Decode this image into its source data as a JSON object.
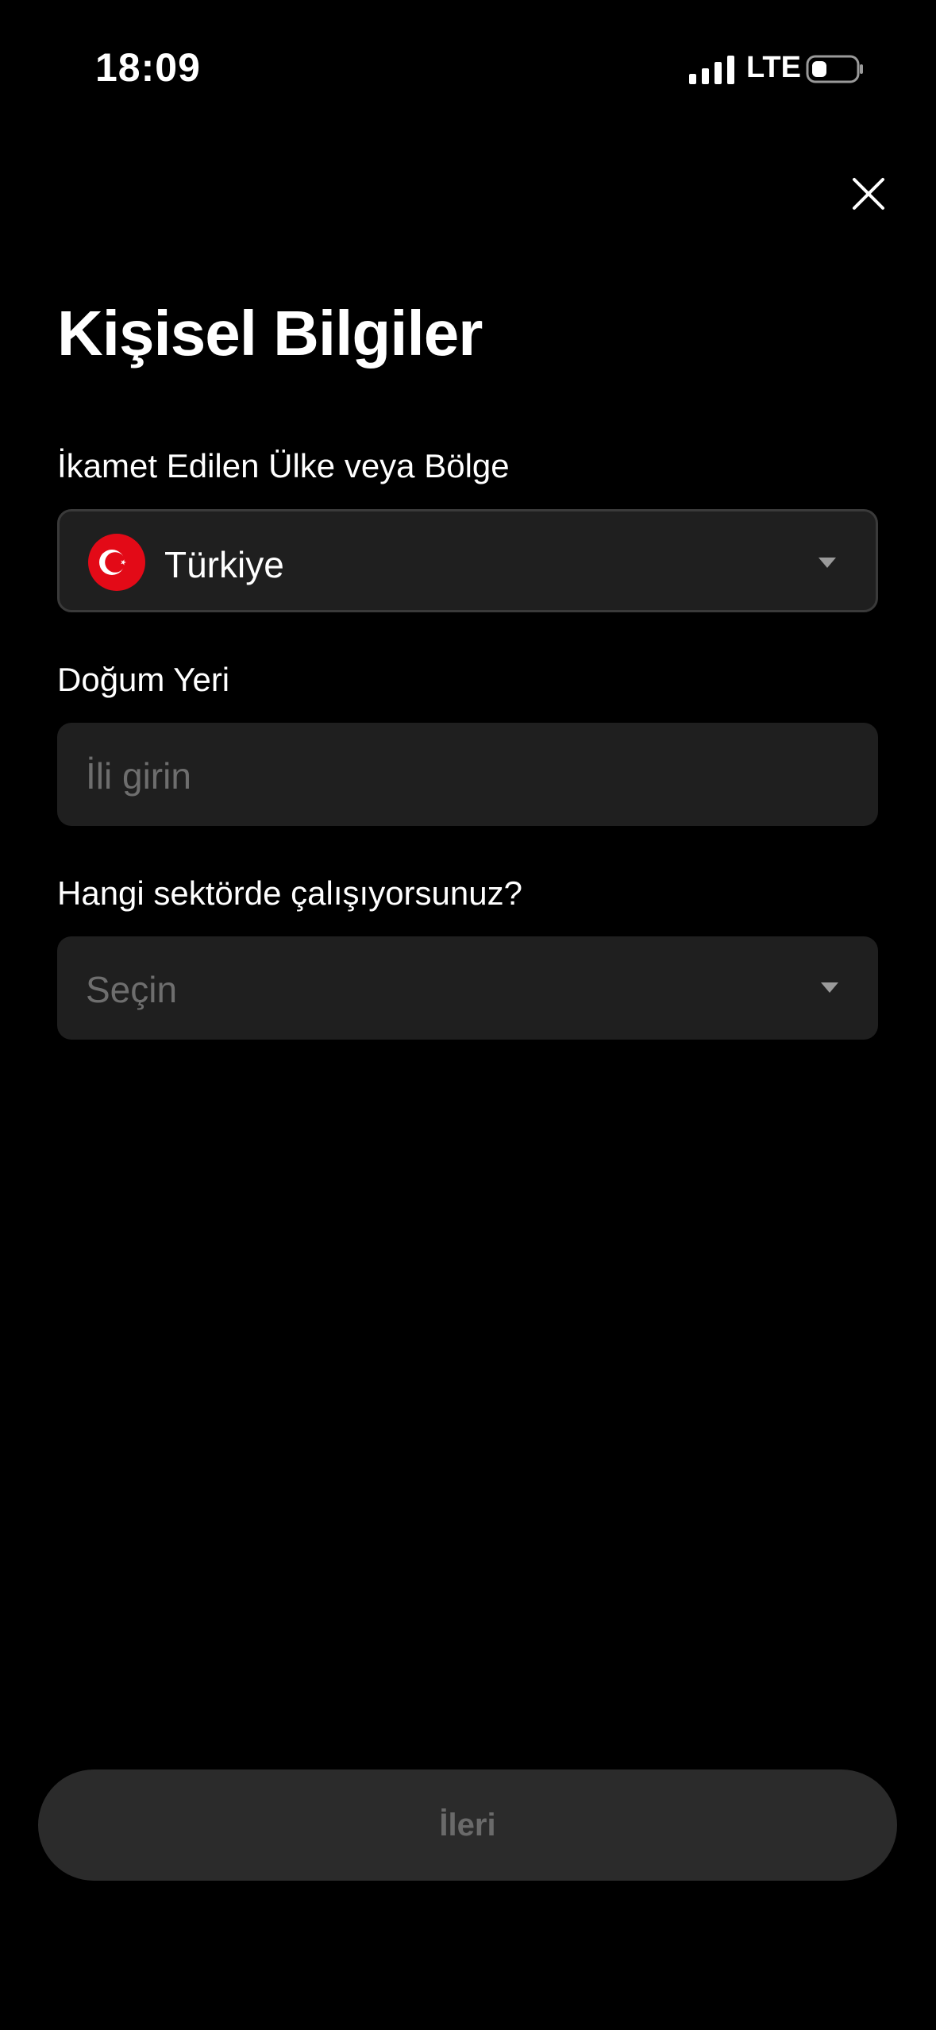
{
  "status_bar": {
    "time": "18:09",
    "network": "LTE",
    "icons": [
      "signal-icon",
      "battery-icon"
    ]
  },
  "header": {
    "close_icon": "close-icon",
    "title": "Kişisel Bilgiler"
  },
  "form": {
    "residence": {
      "label": "İkamet Edilen Ülke veya Bölge",
      "value": "Türkiye",
      "flag_icon": "turkey-flag-icon",
      "flag_color": "#e30a17"
    },
    "birthplace": {
      "label": "Doğum Yeri",
      "placeholder": "İli girin",
      "value": ""
    },
    "sector": {
      "label": "Hangi sektörde çalışıyorsunuz?",
      "placeholder": "Seçin",
      "value": ""
    }
  },
  "footer": {
    "next_label": "İleri",
    "next_enabled": false
  },
  "colors": {
    "background": "#000000",
    "field_background": "#1f1f1f",
    "placeholder": "#6e6e6e",
    "disabled_button": "#2b2b2b",
    "disabled_button_text": "#6a6a6a"
  }
}
